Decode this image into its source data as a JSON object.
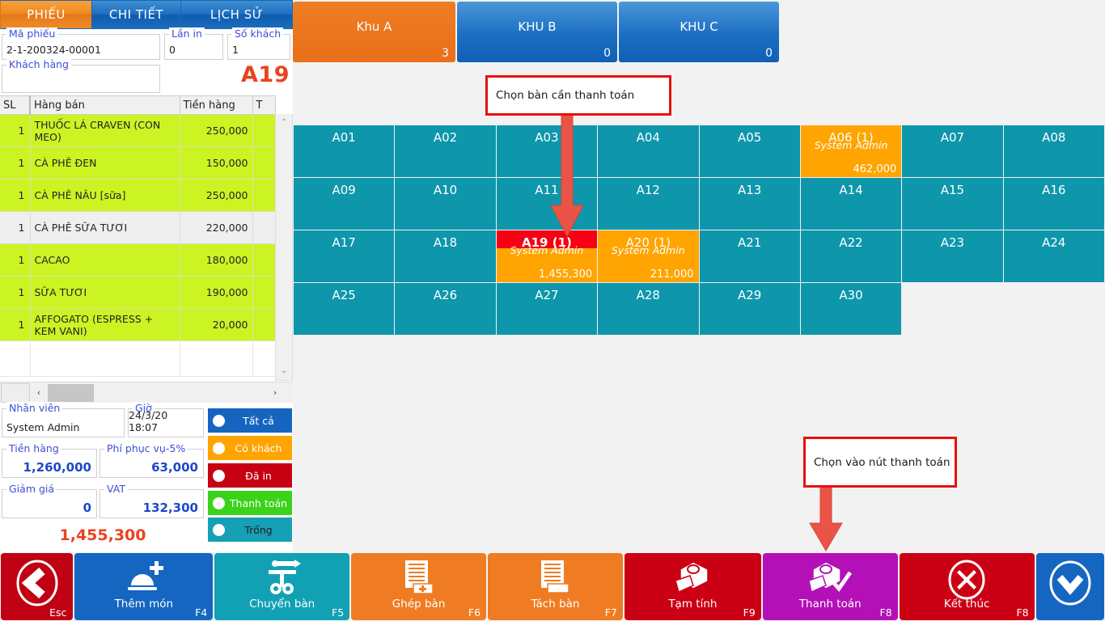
{
  "tabs": [
    {
      "label": "PHIẾU",
      "active": true
    },
    {
      "label": "CHI TIẾT",
      "active": false
    },
    {
      "label": "LỊCH SỬ",
      "active": false
    }
  ],
  "form": {
    "ma_phieu_label": "Mã phiếu",
    "ma_phieu_value": "2-1-200324-00001",
    "lan_in_label": "Lần in",
    "lan_in_value": "0",
    "so_khach_label": "Số khách",
    "so_khach_value": "1",
    "khach_hang_label": "Khách hàng",
    "khach_hang_value": "",
    "table_badge": "A19"
  },
  "items": {
    "headers": [
      "SL",
      "Hàng bán",
      "Tiền hàng",
      "T"
    ],
    "rows": [
      {
        "sl": "1",
        "name": "THUỐC LÁ CRAVEN  (CON MEO)",
        "money": "250,000",
        "t": ""
      },
      {
        "sl": "1",
        "name": "CÀ PHÊ ĐEN",
        "money": "150,000",
        "t": ""
      },
      {
        "sl": "1",
        "name": "CÀ PHÊ NÂU [sữa]",
        "money": "250,000",
        "t": ""
      },
      {
        "sl": "1",
        "name": "CÀ PHÊ SỮA TƯƠI",
        "money": "220,000",
        "t": ""
      },
      {
        "sl": "1",
        "name": "CACAO",
        "money": "180,000",
        "t": ""
      },
      {
        "sl": "1",
        "name": "SỮA TƯƠI",
        "money": "190,000",
        "t": ""
      },
      {
        "sl": "1",
        "name": "AFFOGATO (ESPRESS + KEM VANI)",
        "money": "20,000",
        "t": ""
      }
    ]
  },
  "scrollbar": {
    "up_glyph": "⌃",
    "down_glyph": "⌄",
    "left_glyph": "‹",
    "right_glyph": "›"
  },
  "summary": {
    "nhan_vien_label": "Nhân viên",
    "nhan_vien_value": "System Admin",
    "gio_label": "Giờ",
    "gio_value": "24/3/20 18:07",
    "tien_hang_label": "Tiền hàng",
    "tien_hang_value": "1,260,000",
    "phi_phuc_vu_label": "Phí phục vụ-5%",
    "phi_phuc_vu_value": "63,000",
    "giam_gia_label": "Giảm giá",
    "giam_gia_value": "0",
    "vat_label": "VAT",
    "vat_value": "132,300",
    "grand_total": "1,455,300"
  },
  "legend": [
    {
      "label": "Tất cả",
      "color": "#1565c0"
    },
    {
      "label": "Có khách",
      "color": "#ffa400"
    },
    {
      "label": "Đã in",
      "color": "#c70012"
    },
    {
      "label": "Thanh toán",
      "color": "#3ad31a"
    },
    {
      "label": "Trống",
      "color": "#16a0b5"
    }
  ],
  "zones": [
    {
      "name": "Khu A",
      "count": "3",
      "active": true
    },
    {
      "name": "KHU B",
      "count": "0",
      "active": false
    },
    {
      "name": "KHU C",
      "count": "0",
      "active": false
    }
  ],
  "tables": [
    {
      "name": "A01",
      "state": "empty"
    },
    {
      "name": "A02",
      "state": "empty"
    },
    {
      "name": "A03",
      "state": "empty"
    },
    {
      "name": "A04",
      "state": "empty"
    },
    {
      "name": "A05",
      "state": "empty"
    },
    {
      "name": "A06 (1)",
      "state": "occupied",
      "user": "System Admin",
      "amount": "462,000"
    },
    {
      "name": "A07",
      "state": "empty"
    },
    {
      "name": "A08",
      "state": "empty"
    },
    {
      "name": "A09",
      "state": "empty"
    },
    {
      "name": "A10",
      "state": "empty"
    },
    {
      "name": "A11",
      "state": "empty"
    },
    {
      "name": "A12",
      "state": "empty"
    },
    {
      "name": "A13",
      "state": "empty"
    },
    {
      "name": "A14",
      "state": "empty"
    },
    {
      "name": "A15",
      "state": "empty"
    },
    {
      "name": "A16",
      "state": "empty"
    },
    {
      "name": "A17",
      "state": "empty"
    },
    {
      "name": "A18",
      "state": "empty"
    },
    {
      "name": "A19 (1)",
      "state": "selected",
      "user": "System Admin",
      "amount": "1,455,300"
    },
    {
      "name": "A20 (1)",
      "state": "occupied",
      "user": "System Admin",
      "amount": "211,000"
    },
    {
      "name": "A21",
      "state": "empty"
    },
    {
      "name": "A22",
      "state": "empty"
    },
    {
      "name": "A23",
      "state": "empty"
    },
    {
      "name": "A24",
      "state": "empty"
    },
    {
      "name": "A25",
      "state": "empty"
    },
    {
      "name": "A26",
      "state": "empty"
    },
    {
      "name": "A27",
      "state": "empty"
    },
    {
      "name": "A28",
      "state": "empty"
    },
    {
      "name": "A29",
      "state": "empty"
    },
    {
      "name": "A30",
      "state": "empty"
    },
    {
      "name": "",
      "state": "none"
    },
    {
      "name": "",
      "state": "none"
    }
  ],
  "annotations": [
    {
      "text": "Chọn bàn cần thanh toán"
    },
    {
      "text": "Chọn vào nút thanh toán"
    }
  ],
  "toolbar": [
    {
      "id": "esc",
      "label": "",
      "key": "Esc",
      "icon": "back-chevron-icon",
      "color": "#c00114"
    },
    {
      "id": "them",
      "label": "Thêm món",
      "key": "F4",
      "icon": "add-dish-icon",
      "color": "#1566c0"
    },
    {
      "id": "chuyen",
      "label": "Chuyển bàn",
      "key": "F5",
      "icon": "move-table-icon",
      "color": "#12a0b4"
    },
    {
      "id": "ghep",
      "label": "Ghép bàn",
      "key": "F6",
      "icon": "merge-bill-icon",
      "color": "#ef7c22"
    },
    {
      "id": "tach",
      "label": "Tách bàn",
      "key": "F7",
      "icon": "split-bill-icon",
      "color": "#ef7c22"
    },
    {
      "id": "tam",
      "label": "Tạm tính",
      "key": "F9",
      "icon": "provisional-bill-icon",
      "color": "#cc0015"
    },
    {
      "id": "thanh",
      "label": "Thanh toán",
      "key": "F8",
      "icon": "payment-check-icon",
      "color": "#b310b8"
    },
    {
      "id": "ket",
      "label": "Kết thúc",
      "key": "F8",
      "icon": "close-x-icon",
      "color": "#cc0015"
    },
    {
      "id": "down",
      "label": "",
      "key": "",
      "icon": "chevron-down-icon",
      "color": "#1566c0"
    }
  ],
  "colors": {
    "teal_table": "#0e96ab",
    "orange_occupied": "#ffa400",
    "red_selected": "#f50015",
    "accent_orange": "#e8431f",
    "row_green": "#ccf423",
    "blue": "#1566c0",
    "annotation_red": "#e8100f"
  }
}
